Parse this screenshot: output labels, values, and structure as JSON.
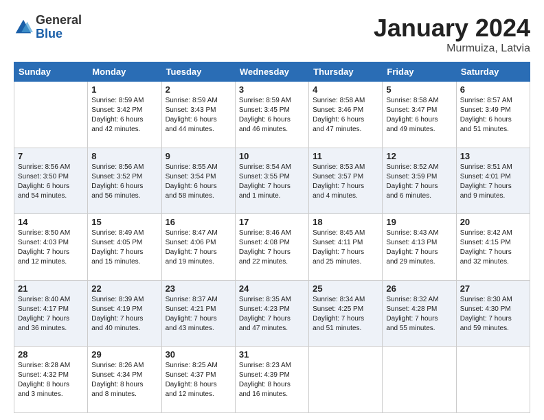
{
  "header": {
    "logo": {
      "general": "General",
      "blue": "Blue"
    },
    "title": "January 2024",
    "location": "Murmuiza, Latvia"
  },
  "calendar": {
    "days_of_week": [
      "Sunday",
      "Monday",
      "Tuesday",
      "Wednesday",
      "Thursday",
      "Friday",
      "Saturday"
    ],
    "weeks": [
      [
        {
          "day": "",
          "info": ""
        },
        {
          "day": "1",
          "info": "Sunrise: 8:59 AM\nSunset: 3:42 PM\nDaylight: 6 hours\nand 42 minutes."
        },
        {
          "day": "2",
          "info": "Sunrise: 8:59 AM\nSunset: 3:43 PM\nDaylight: 6 hours\nand 44 minutes."
        },
        {
          "day": "3",
          "info": "Sunrise: 8:59 AM\nSunset: 3:45 PM\nDaylight: 6 hours\nand 46 minutes."
        },
        {
          "day": "4",
          "info": "Sunrise: 8:58 AM\nSunset: 3:46 PM\nDaylight: 6 hours\nand 47 minutes."
        },
        {
          "day": "5",
          "info": "Sunrise: 8:58 AM\nSunset: 3:47 PM\nDaylight: 6 hours\nand 49 minutes."
        },
        {
          "day": "6",
          "info": "Sunrise: 8:57 AM\nSunset: 3:49 PM\nDaylight: 6 hours\nand 51 minutes."
        }
      ],
      [
        {
          "day": "7",
          "info": "Sunrise: 8:56 AM\nSunset: 3:50 PM\nDaylight: 6 hours\nand 54 minutes."
        },
        {
          "day": "8",
          "info": "Sunrise: 8:56 AM\nSunset: 3:52 PM\nDaylight: 6 hours\nand 56 minutes."
        },
        {
          "day": "9",
          "info": "Sunrise: 8:55 AM\nSunset: 3:54 PM\nDaylight: 6 hours\nand 58 minutes."
        },
        {
          "day": "10",
          "info": "Sunrise: 8:54 AM\nSunset: 3:55 PM\nDaylight: 7 hours\nand 1 minute."
        },
        {
          "day": "11",
          "info": "Sunrise: 8:53 AM\nSunset: 3:57 PM\nDaylight: 7 hours\nand 4 minutes."
        },
        {
          "day": "12",
          "info": "Sunrise: 8:52 AM\nSunset: 3:59 PM\nDaylight: 7 hours\nand 6 minutes."
        },
        {
          "day": "13",
          "info": "Sunrise: 8:51 AM\nSunset: 4:01 PM\nDaylight: 7 hours\nand 9 minutes."
        }
      ],
      [
        {
          "day": "14",
          "info": "Sunrise: 8:50 AM\nSunset: 4:03 PM\nDaylight: 7 hours\nand 12 minutes."
        },
        {
          "day": "15",
          "info": "Sunrise: 8:49 AM\nSunset: 4:05 PM\nDaylight: 7 hours\nand 15 minutes."
        },
        {
          "day": "16",
          "info": "Sunrise: 8:47 AM\nSunset: 4:06 PM\nDaylight: 7 hours\nand 19 minutes."
        },
        {
          "day": "17",
          "info": "Sunrise: 8:46 AM\nSunset: 4:08 PM\nDaylight: 7 hours\nand 22 minutes."
        },
        {
          "day": "18",
          "info": "Sunrise: 8:45 AM\nSunset: 4:11 PM\nDaylight: 7 hours\nand 25 minutes."
        },
        {
          "day": "19",
          "info": "Sunrise: 8:43 AM\nSunset: 4:13 PM\nDaylight: 7 hours\nand 29 minutes."
        },
        {
          "day": "20",
          "info": "Sunrise: 8:42 AM\nSunset: 4:15 PM\nDaylight: 7 hours\nand 32 minutes."
        }
      ],
      [
        {
          "day": "21",
          "info": "Sunrise: 8:40 AM\nSunset: 4:17 PM\nDaylight: 7 hours\nand 36 minutes."
        },
        {
          "day": "22",
          "info": "Sunrise: 8:39 AM\nSunset: 4:19 PM\nDaylight: 7 hours\nand 40 minutes."
        },
        {
          "day": "23",
          "info": "Sunrise: 8:37 AM\nSunset: 4:21 PM\nDaylight: 7 hours\nand 43 minutes."
        },
        {
          "day": "24",
          "info": "Sunrise: 8:35 AM\nSunset: 4:23 PM\nDaylight: 7 hours\nand 47 minutes."
        },
        {
          "day": "25",
          "info": "Sunrise: 8:34 AM\nSunset: 4:25 PM\nDaylight: 7 hours\nand 51 minutes."
        },
        {
          "day": "26",
          "info": "Sunrise: 8:32 AM\nSunset: 4:28 PM\nDaylight: 7 hours\nand 55 minutes."
        },
        {
          "day": "27",
          "info": "Sunrise: 8:30 AM\nSunset: 4:30 PM\nDaylight: 7 hours\nand 59 minutes."
        }
      ],
      [
        {
          "day": "28",
          "info": "Sunrise: 8:28 AM\nSunset: 4:32 PM\nDaylight: 8 hours\nand 3 minutes."
        },
        {
          "day": "29",
          "info": "Sunrise: 8:26 AM\nSunset: 4:34 PM\nDaylight: 8 hours\nand 8 minutes."
        },
        {
          "day": "30",
          "info": "Sunrise: 8:25 AM\nSunset: 4:37 PM\nDaylight: 8 hours\nand 12 minutes."
        },
        {
          "day": "31",
          "info": "Sunrise: 8:23 AM\nSunset: 4:39 PM\nDaylight: 8 hours\nand 16 minutes."
        },
        {
          "day": "",
          "info": ""
        },
        {
          "day": "",
          "info": ""
        },
        {
          "day": "",
          "info": ""
        }
      ]
    ]
  }
}
